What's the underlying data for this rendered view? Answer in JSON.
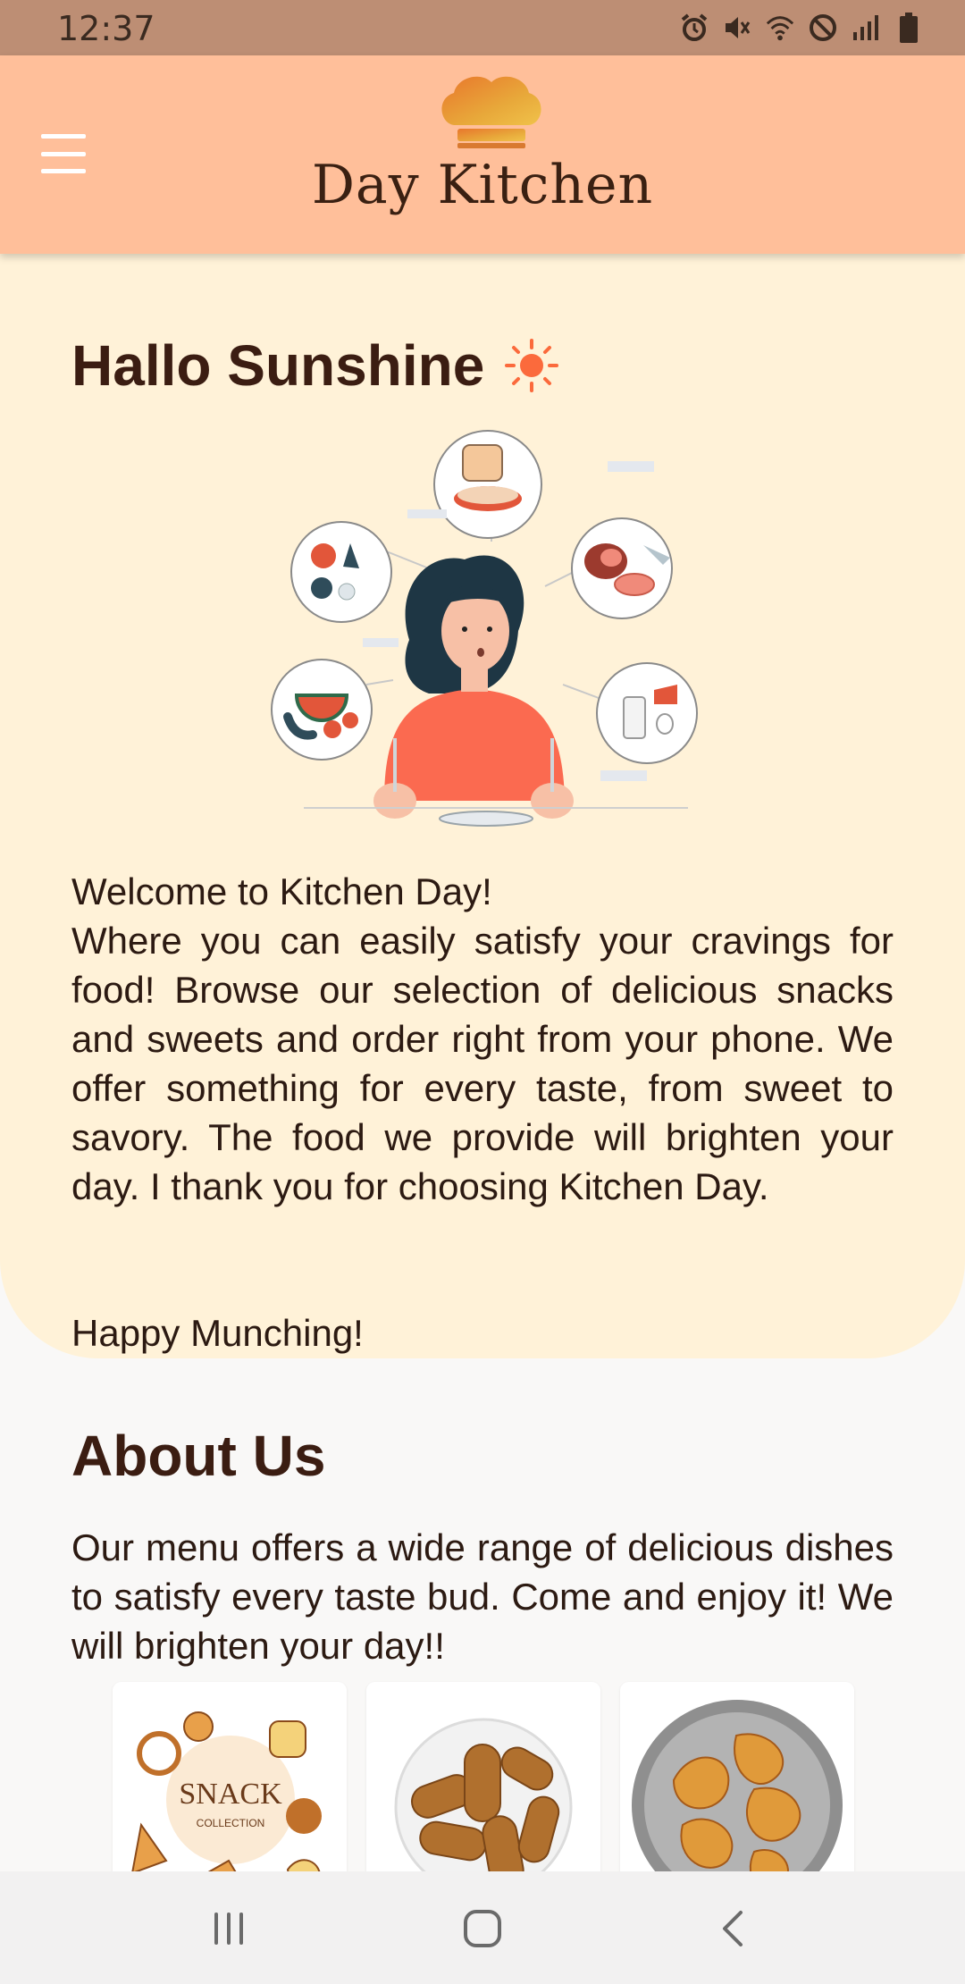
{
  "status_bar": {
    "time": "12:37",
    "icons": [
      "alarm-icon",
      "mute-icon",
      "wifi-icon",
      "do-not-disturb-icon",
      "signal-icon",
      "battery-icon"
    ]
  },
  "header": {
    "menu_icon": "hamburger-menu-icon",
    "logo_text": "Day Kitchen"
  },
  "intro": {
    "greeting": "Hallo Sunshine",
    "greeting_icon": "sun-icon",
    "welcome_title": "Welcome to Kitchen Day!",
    "welcome_body": "Where you can easily satisfy your cravings for food! Browse our selection of delicious snacks and sweets and order right from your phone. We offer something for every taste, from sweet to savory. The food we provide will brighten your day. I thank you for choosing Kitchen Day.",
    "closing": "Happy Munching!"
  },
  "about": {
    "title": "About Us",
    "body": "Our menu offers a wide range of delicious dishes to satisfy every taste bud. Come and enjoy it! We will brighten your day!!"
  },
  "cards": [
    {
      "label": "SNACK",
      "sublabel": "COLLECTION"
    },
    {
      "label": ""
    },
    {
      "label": ""
    }
  ],
  "nav": {
    "recents": "recents-icon",
    "home": "home-icon",
    "back": "back-icon"
  },
  "colors": {
    "status_bar": "#bd8e74",
    "header": "#ffbf9a",
    "card_bg": "#fff2d8",
    "heading": "#3b1d12",
    "accent": "#fb6a3c"
  }
}
